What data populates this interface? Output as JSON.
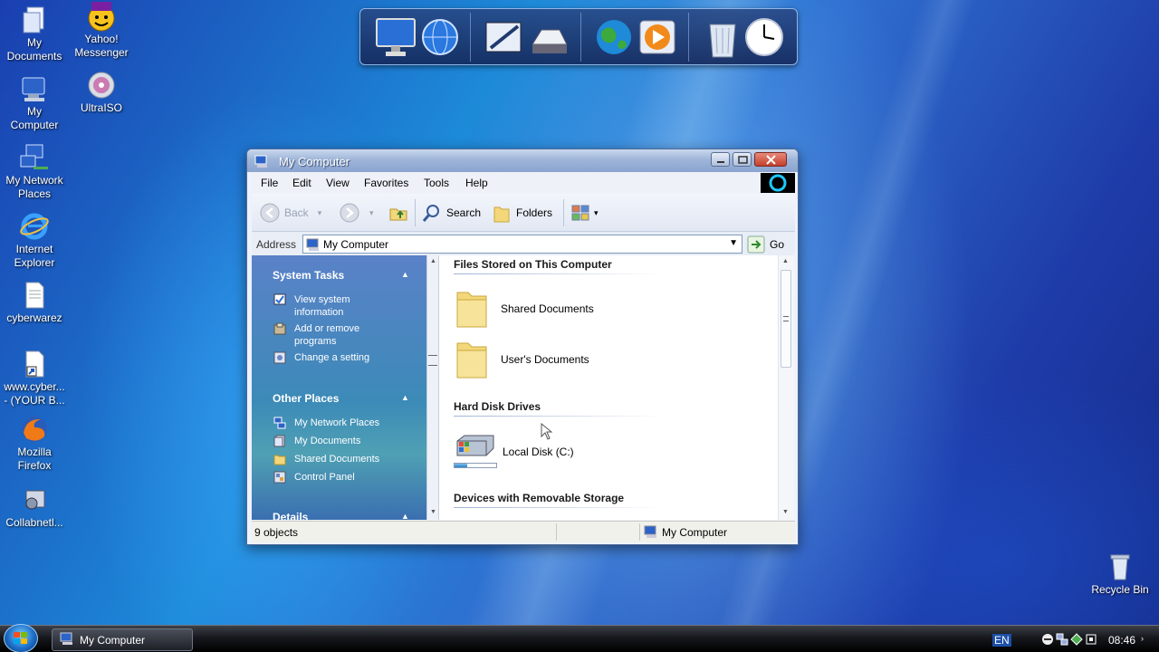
{
  "desktop": {
    "icons": [
      {
        "label": "My\nDocuments"
      },
      {
        "label": "Yahoo!\nMessenger"
      },
      {
        "label": "My\nComputer"
      },
      {
        "label": "UltraISO"
      },
      {
        "label": "My Network\nPlaces"
      },
      {
        "label": "Internet\nExplorer"
      },
      {
        "label": "cyberwarez"
      },
      {
        "label": "www.cyber...\n- (YOUR B..."
      },
      {
        "label": "Mozilla\nFirefox"
      },
      {
        "label": "Collabnetl..."
      },
      {
        "label": "Recycle Bin"
      }
    ]
  },
  "dock": {
    "items": [
      "monitor-icon",
      "globe-icon",
      "pen-tool-icon",
      "mail-tray-icon",
      "earth-icon",
      "media-player-icon",
      "trash-icon",
      "clock-icon"
    ]
  },
  "window": {
    "title": "My Computer",
    "menu": [
      "File",
      "Edit",
      "View",
      "Favorites",
      "Tools",
      "Help"
    ],
    "toolbar": {
      "back": "Back",
      "search": "Search",
      "folders": "Folders"
    },
    "address": {
      "label": "Address",
      "value": "My Computer",
      "go": "Go"
    },
    "taskpane": {
      "system_tasks": {
        "title": "System Tasks",
        "items": [
          "View system\ninformation",
          "Add or remove\nprograms",
          "Change a setting"
        ]
      },
      "other_places": {
        "title": "Other Places",
        "items": [
          "My Network Places",
          "My Documents",
          "Shared Documents",
          "Control Panel"
        ]
      },
      "details": {
        "title": "Details"
      }
    },
    "content": {
      "sections": [
        {
          "title": "Files Stored on This Computer",
          "items": [
            "Shared Documents",
            "User's Documents"
          ]
        },
        {
          "title": "Hard Disk Drives",
          "items": [
            "Local Disk (C:)"
          ]
        },
        {
          "title": "Devices with Removable Storage",
          "items": []
        }
      ],
      "disk_usage_fraction": 0.3
    },
    "status": {
      "objects": "9 objects",
      "location": "My Computer"
    }
  },
  "taskbar": {
    "task_button": "My Computer",
    "language": "EN",
    "time": "08:46"
  },
  "colors": {
    "taskpane_blue": "#3c8ab8",
    "folder_yellow": "#f3d77a",
    "close_red": "#c4402c"
  }
}
